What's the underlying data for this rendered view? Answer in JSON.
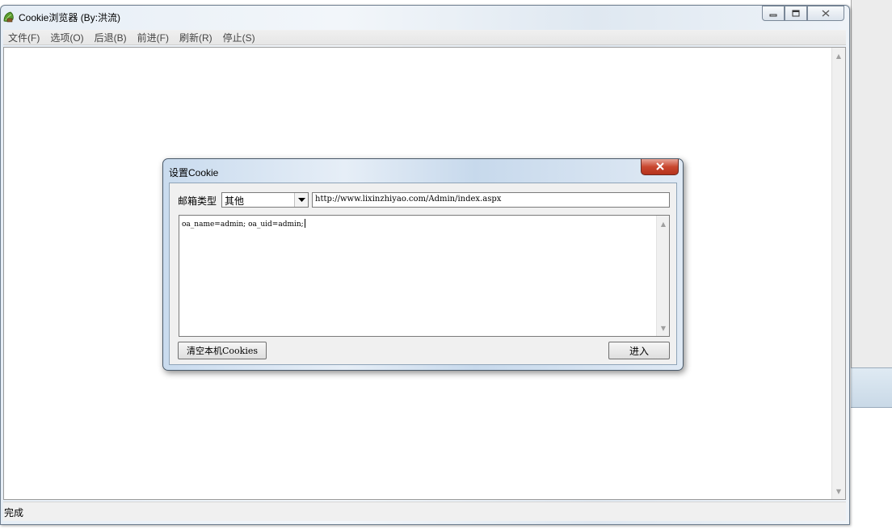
{
  "window": {
    "title": "Cookie浏览器 (By:洪流)",
    "icon": "green-leaf-app-icon"
  },
  "caption_buttons": {
    "minimize_icon": "minimize-icon",
    "maximize_icon": "maximize-icon",
    "close_icon": "close-icon"
  },
  "menu": {
    "items": [
      {
        "label": "文件(F)"
      },
      {
        "label": "选项(O)"
      },
      {
        "label": "后退(B)"
      },
      {
        "label": "前进(F)"
      },
      {
        "label": "刷新(R)"
      },
      {
        "label": "停止(S)"
      }
    ]
  },
  "status": {
    "text": "完成"
  },
  "dialog": {
    "title": "设置Cookie",
    "mailbox_label": "邮箱类型",
    "mailbox_selected": "其他",
    "url": "http://www.lixinzhiyao.com/Admin/index.aspx",
    "cookie_text": "oa_name=admin; oa_uid=admin;",
    "clear_button": "清空本机Cookies",
    "enter_button": "进入"
  },
  "colors": {
    "dialog_close": "#c9472f",
    "window_frame": "#dfe8f1"
  }
}
